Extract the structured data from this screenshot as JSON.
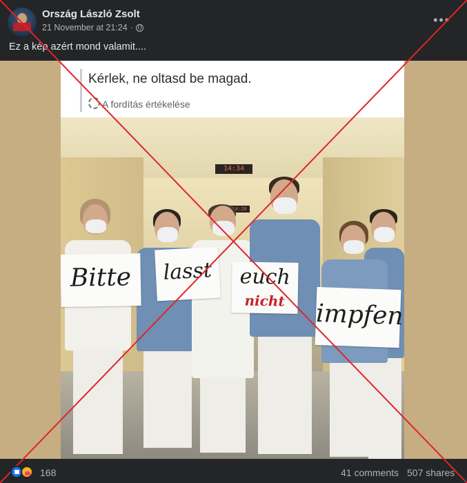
{
  "post": {
    "author": "Ország László Zsolt",
    "timestamp": "21 November at 21:24",
    "separator": "·",
    "text": "Ez a kép azért mond valamit...."
  },
  "image": {
    "caption_main": "Kérlek, ne oltasd be magad.",
    "caption_sub": "A fordítás értékelése",
    "clock_main": "14:34",
    "clock_small": "14:28",
    "signs": [
      "Bitte",
      "lasst",
      "euch",
      "nicht",
      "impfen"
    ]
  },
  "footer": {
    "reaction_count": "168",
    "comments": "41 comments",
    "shares": "507 shares"
  },
  "colors": {
    "background": "#242526",
    "overlay_cross": "#e0242b",
    "sign_red": "#c4232b",
    "scrubs": "#6f8fb4"
  },
  "icons": {
    "privacy": "globe-icon",
    "menu": "more-icon",
    "translate": "gear-icon",
    "reactions": [
      "like-icon",
      "care-icon"
    ]
  }
}
